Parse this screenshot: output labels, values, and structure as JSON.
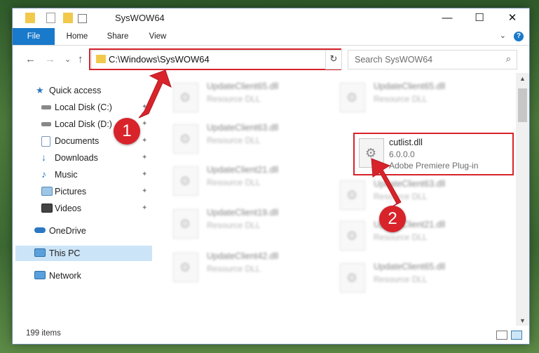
{
  "window": {
    "title": "SysWOW64",
    "controls": {
      "minimize": "—",
      "maximize": "☐",
      "close": "✕"
    }
  },
  "ribbon": {
    "tabs": [
      "File",
      "Home",
      "Share",
      "View"
    ],
    "expand_glyph": "⌄",
    "help_glyph": "?"
  },
  "nav": {
    "back_glyph": "←",
    "forward_glyph": "→",
    "recent_glyph": "⌄",
    "up_glyph": "↑",
    "address": "C:\\Windows\\SysWOW64",
    "address_drop_glyph": "⌄",
    "refresh_glyph": "↻",
    "search_placeholder": "Search SysWOW64",
    "search_icon": "search-icon"
  },
  "sidebar": {
    "items": [
      {
        "label": "Quick access",
        "icon": "star-icon",
        "pinned": false
      },
      {
        "label": "Local Disk (C:)",
        "icon": "drive-icon",
        "pinned": true
      },
      {
        "label": "Local Disk (D:)",
        "icon": "drive-icon",
        "pinned": true
      },
      {
        "label": "Documents",
        "icon": "documents-icon",
        "pinned": true
      },
      {
        "label": "Downloads",
        "icon": "download-icon",
        "pinned": true
      },
      {
        "label": "Music",
        "icon": "music-icon",
        "pinned": true
      },
      {
        "label": "Pictures",
        "icon": "pictures-icon",
        "pinned": true
      },
      {
        "label": "Videos",
        "icon": "videos-icon",
        "pinned": true
      },
      {
        "label": "OneDrive",
        "icon": "cloud-icon",
        "pinned": false
      },
      {
        "label": "This PC",
        "icon": "pc-icon",
        "pinned": false,
        "selected": true
      },
      {
        "label": "Network",
        "icon": "network-icon",
        "pinned": false
      }
    ],
    "pin_glyph": "📌"
  },
  "files": {
    "left_column": [
      {
        "name": "UpdateClient65.dll",
        "type": "Resource DLL"
      },
      {
        "name": "UpdateClient63.dll",
        "type": "Resource DLL"
      },
      {
        "name": "UpdateClient21.dll",
        "type": "Resource DLL"
      },
      {
        "name": "UpdateClient19.dll",
        "type": "Resource DLL"
      },
      {
        "name": "UpdateClient42.dll",
        "type": "Resource DLL"
      }
    ],
    "right_column": [
      {
        "name": "UpdateClient65.dll",
        "type": "Resource DLL"
      },
      {
        "name": "cutlist.dll",
        "version": "6.0.0.0",
        "type": "Adobe Premiere Plug-in",
        "highlighted": true
      },
      {
        "name": "UpdateClient63.dll",
        "type": "Resource DLL"
      },
      {
        "name": "UpdateClient21.dll",
        "type": "Resource DLL"
      },
      {
        "name": "UpdateClient65.dll",
        "type": "Resource DLL"
      }
    ]
  },
  "status": {
    "item_count": "199 items"
  },
  "callouts": {
    "first": "1",
    "second": "2"
  },
  "colors": {
    "accent": "#1979ca",
    "highlight": "#d8232a",
    "selection": "#cce4f7"
  }
}
